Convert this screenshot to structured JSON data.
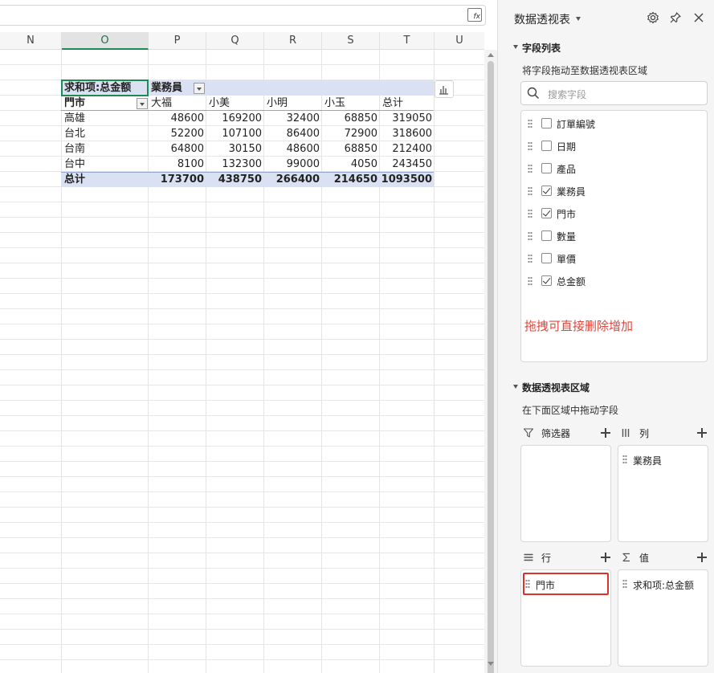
{
  "sheet": {
    "columns": [
      "N",
      "O",
      "P",
      "Q",
      "R",
      "S",
      "T",
      "U"
    ],
    "selected_column": "O",
    "fx_label": "fx"
  },
  "pivot": {
    "header_value_field": "求和项:总金额",
    "header_col_field": "業務員",
    "row_field": "門市",
    "col_labels": [
      "大福",
      "小美",
      "小明",
      "小玉",
      "总计"
    ],
    "rows": [
      {
        "label": "高雄",
        "values": [
          "48600",
          "169200",
          "32400",
          "68850",
          "319050"
        ]
      },
      {
        "label": "台北",
        "values": [
          "52200",
          "107100",
          "86400",
          "72900",
          "318600"
        ]
      },
      {
        "label": "台南",
        "values": [
          "64800",
          "30150",
          "48600",
          "68850",
          "212400"
        ]
      },
      {
        "label": "台中",
        "values": [
          "8100",
          "132300",
          "99000",
          "4050",
          "243450"
        ]
      }
    ],
    "total": {
      "label": "总计",
      "values": [
        "173700",
        "438750",
        "266400",
        "214650",
        "1093500"
      ]
    }
  },
  "pane": {
    "title": "数据透视表",
    "field_list_title": "字段列表",
    "field_list_hint": "将字段拖动至数据透视表区域",
    "search_placeholder": "搜索字段",
    "fields": [
      {
        "label": "訂單編號",
        "checked": false
      },
      {
        "label": "日期",
        "checked": false
      },
      {
        "label": "產品",
        "checked": false
      },
      {
        "label": "業務員",
        "checked": true
      },
      {
        "label": "門市",
        "checked": true
      },
      {
        "label": "數量",
        "checked": false
      },
      {
        "label": "單價",
        "checked": false
      },
      {
        "label": "总金额",
        "checked": true
      }
    ],
    "annotation": "拖拽可直接删除增加",
    "areas_title": "数据透视表区域",
    "areas_hint": "在下面区域中拖动字段",
    "filter_label": "筛选器",
    "columns_label": "列",
    "rows_label": "行",
    "values_label": "值",
    "columns_item": "業務員",
    "rows_item": "門市",
    "values_item": "求和项:总金额"
  },
  "colors": {
    "accent_green": "#1e8a54",
    "pivot_band": "#dae1f2",
    "annotation_red": "#e0463c",
    "highlight_box": "#d9342b"
  }
}
